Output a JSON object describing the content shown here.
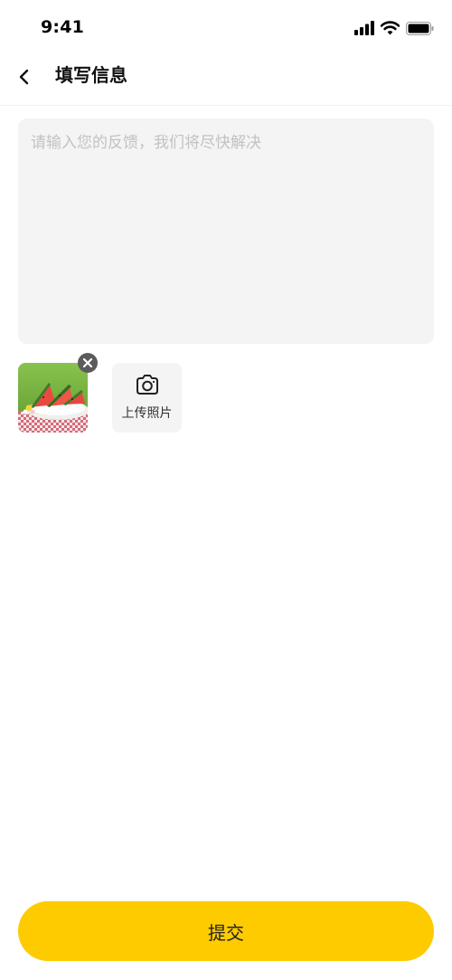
{
  "status_bar": {
    "time": "9:41",
    "icons": [
      "signal-icon",
      "wifi-icon",
      "battery-icon"
    ]
  },
  "nav": {
    "back_icon": "chevron-left-icon",
    "title": "填写信息"
  },
  "feedback": {
    "value": "",
    "placeholder": "请输入您的反馈，我们将尽快解决"
  },
  "photos": {
    "items": [
      {
        "subject": "watermelon slices on a plate",
        "remove_icon": "close-icon"
      }
    ],
    "upload_icon": "camera-icon",
    "upload_label": "上传照片"
  },
  "submit": {
    "label": "提交"
  },
  "colors": {
    "accent": "#fdcb00",
    "input_background": "#f4f4f4",
    "placeholder_text": "#c2c2c2",
    "remove_badge": "#5b5b5b"
  }
}
